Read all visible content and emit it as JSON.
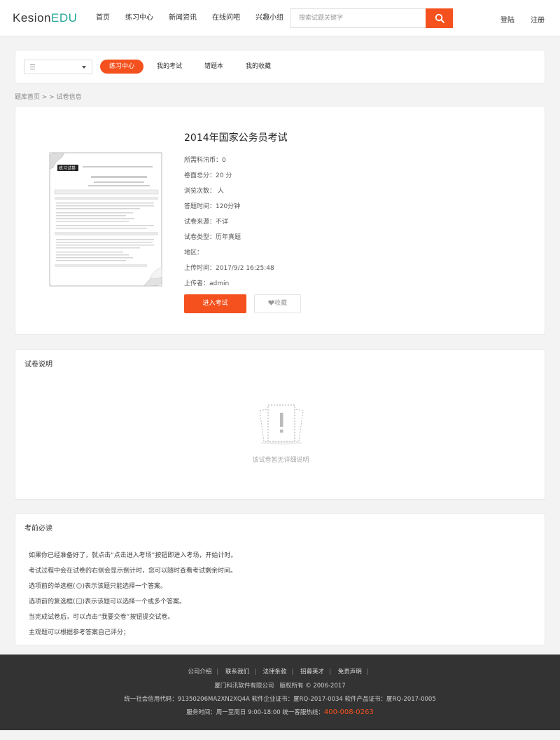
{
  "header": {
    "logo_main": "Kesion",
    "logo_accent": "EDU",
    "nav": [
      "首页",
      "练习中心",
      "新闻资讯",
      "在线问吧",
      "兴趣小组"
    ],
    "search_placeholder": "搜索试题关键字",
    "login": "登陆",
    "register": "注册"
  },
  "tabbar": {
    "tabs": [
      "练习中心",
      "我的考试",
      "错题本",
      "我的收藏"
    ],
    "active_tab": 0
  },
  "breadcrumb": "题库首页 >   > 试卷信息",
  "exam": {
    "title": "2014年国家公务员考试",
    "fields": [
      "所需科汛币：0",
      "卷面总分：20 分",
      "浏览次数： 人",
      "答题时间：120分钟",
      "试卷来源：不详",
      "试卷类型：历年真题",
      "地区：",
      "上传时间：2017/9/2 16:25:48",
      "上传者：admin"
    ],
    "enter_button": "进入考试",
    "favorite_button": "收藏",
    "thumbnail_badge": "练习试卷"
  },
  "description": {
    "title": "试卷说明",
    "empty_text": "该试卷暂无详细说明"
  },
  "notice": {
    "title": "考前必读",
    "line1": "如果你已经准备好了，就点击“点击进入考场”按钮即进入考场，开始计时。",
    "line2": "考试过程中会在试卷的右侧会显示倒计时，您可以随时查看考试剩余时间。",
    "line3_a": "选项前的单选框(",
    "line3_b": ")表示该题只能选择一个答案。",
    "line4_a": "选项前的复选框(",
    "line4_b": ")表示该题可以选择一个或多个答案。",
    "line5": "当完成试卷后，可以点击“我要交卷”按钮提交试卷。",
    "line6": "主观题可以根据参考答案自己评分；"
  },
  "footer": {
    "links": [
      "公司介绍",
      "联系我们",
      "法律条款",
      "招募英才",
      "免责声明"
    ],
    "company": "厦门科汛软件有限公司",
    "copyright": "版权所有 © 2006-2017",
    "credit": "统一社会信用代码：91350206MA2XN2XQ4A 软件企业证书：厦RQ-2017-0034 软件产品证书：厦RQ-2017-0005",
    "service": "服务时间：周一至周日 9:00-18:00 统一客服热线：",
    "hotline": "400-008-0263"
  },
  "colors": {
    "accent": "#f4511e",
    "logo_accent": "#26a69a",
    "footer_bg": "#333333"
  }
}
